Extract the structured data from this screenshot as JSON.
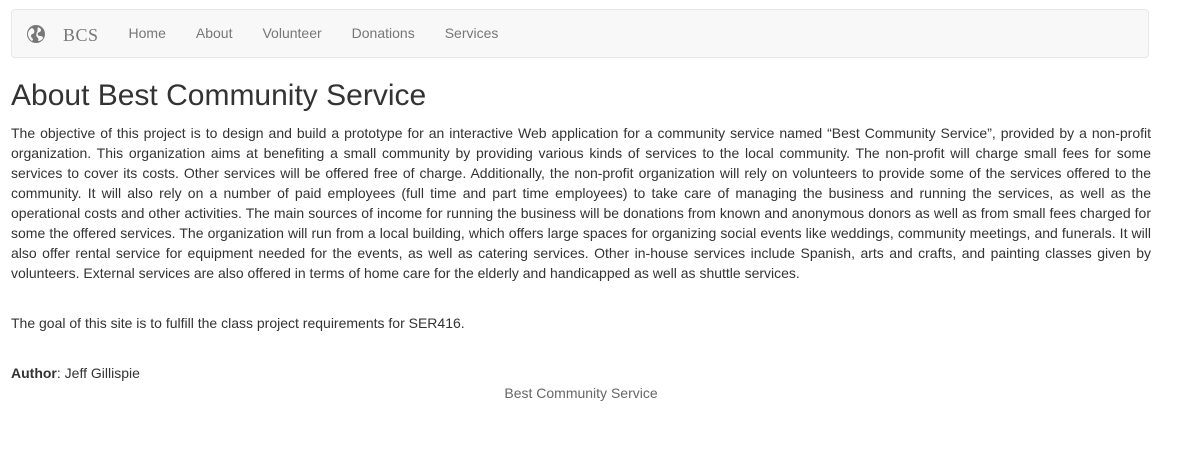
{
  "navbar": {
    "brand_icon": "globe-icon",
    "brand": "BCS",
    "links": [
      "Home",
      "About",
      "Volunteer",
      "Donations",
      "Services"
    ]
  },
  "page": {
    "title": "About Best Community Service",
    "intro": "The objective of this project is to design and build a prototype for an interactive Web application for a community service named “Best Community Service”, provided by a non-profit organization. This organization aims at benefiting a small community by providing various kinds of services to the local community. The non-profit will charge small fees for some services to cover its costs. Other services will be offered free of charge. Additionally, the non-profit organization will rely on volunteers to provide some of the services offered to the community. It will also rely on a number of paid employees (full time and part time employees) to take care of managing the business and running the services, as well as the operational costs and other activities. The main sources of income for running the business will be donations from known and anonymous donors as well as from small fees charged for some the offered services. The organization will run from a local building, which offers large spaces for organizing social events like weddings, community meetings, and funerals. It will also offer rental service for equipment needed for the events, as well as catering services. Other in-house services include Spanish, arts and crafts, and painting classes given by volunteers. External services are also offered in terms of home care for the elderly and handicapped as well as shuttle services.",
    "goal": "The goal of this site is to fulfill the class project requirements for SER416.",
    "author_label": "Author",
    "author_name": ": Jeff Gillispie"
  },
  "footer": {
    "text": "Best Community Service"
  },
  "colors": {
    "navbar_bg": "#f8f8f8",
    "navbar_border": "#e7e7e7",
    "nav_text": "#777777",
    "body_text": "#333333"
  }
}
